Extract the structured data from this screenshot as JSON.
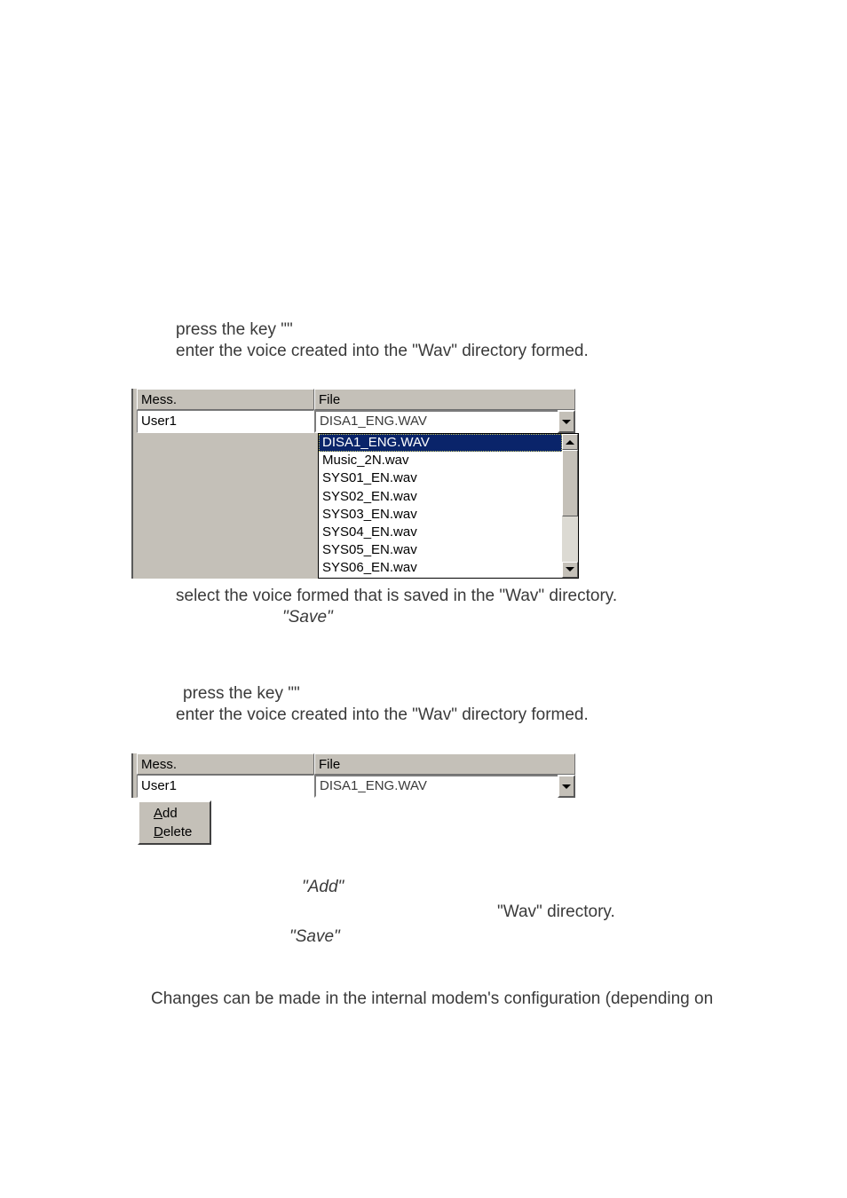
{
  "text": {
    "line1a": "press the key \"",
    "line1b": "\"",
    "line2": "enter the voice created into the \"Wav\" directory formed.",
    "line3": "select the voice formed that is saved in the \"Wav\" directory.",
    "save_quoted": "\"Save\"",
    "line4a": " press the key \"",
    "line4b": "\"",
    "line5": "enter the voice created into the \"Wav\" directory formed.",
    "add_quoted": "\"Add\"",
    "wav_dir": "\"Wav\" directory.",
    "last": "Changes can be made in the internal modem's configuration (depending on"
  },
  "scr1": {
    "hdr_mess": "Mess.",
    "hdr_file": "File",
    "row_mess": "User1",
    "row_file": "DISA1_ENG.WAV",
    "list": [
      "DISA1_ENG.WAV",
      "Music_2N.wav",
      "SYS01_EN.wav",
      "SYS02_EN.wav",
      "SYS03_EN.wav",
      "SYS04_EN.wav",
      "SYS05_EN.wav",
      "SYS06_EN.wav"
    ]
  },
  "scr2": {
    "hdr_mess": "Mess.",
    "hdr_file": "File",
    "row_mess": "User1",
    "row_file": "DISA1_ENG.WAV",
    "menu": {
      "add_accel": "A",
      "add_rest": "dd",
      "del_accel": "D",
      "del_rest": "elete"
    }
  }
}
